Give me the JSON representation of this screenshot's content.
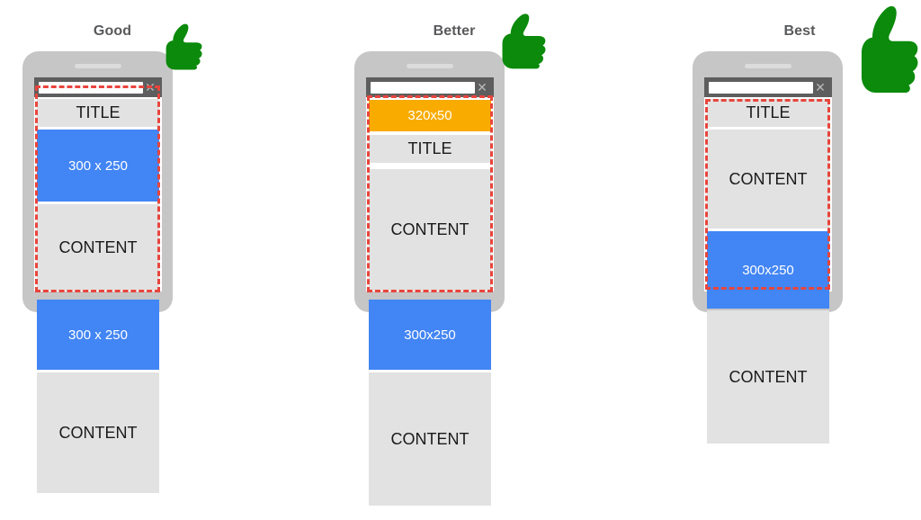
{
  "columns": [
    {
      "title": "Good",
      "browser": {
        "close_icon": "close-icon",
        "url_value": ""
      },
      "blocks": [
        {
          "name": "title-block",
          "label": "TITLE"
        },
        {
          "name": "ad-block",
          "label": "300 x 250"
        },
        {
          "name": "content-block",
          "label": "CONTENT"
        },
        {
          "name": "ad-block-below-fold",
          "label": "300 x 250"
        },
        {
          "name": "content-block-below-fold",
          "label": "CONTENT"
        }
      ]
    },
    {
      "title": "Better",
      "browser": {
        "close_icon": "close-icon",
        "url_value": ""
      },
      "blocks": [
        {
          "name": "banner-ad-block",
          "label": "320x50"
        },
        {
          "name": "title-block",
          "label": "TITLE"
        },
        {
          "name": "content-block",
          "label": "CONTENT"
        },
        {
          "name": "ad-block-below-fold",
          "label": "300x250"
        },
        {
          "name": "content-block-below-fold",
          "label": "CONTENT"
        }
      ]
    },
    {
      "title": "Best",
      "browser": {
        "close_icon": "close-icon",
        "url_value": ""
      },
      "blocks": [
        {
          "name": "title-block",
          "label": "TITLE"
        },
        {
          "name": "content-block",
          "label": "CONTENT"
        },
        {
          "name": "ad-block",
          "label": "300x250"
        },
        {
          "name": "content-block-below-fold",
          "label": "CONTENT"
        }
      ]
    }
  ],
  "icons": {
    "thumbs_up": "thumbs-up-icon"
  },
  "colors": {
    "ad_blue": "#4285f4",
    "banner_amber": "#f9ab00",
    "content_grey": "#e2e2e2",
    "phone_frame": "#c6c6c6",
    "chrome_bar": "#5e5e5e",
    "viewport_outline_red": "#e8453c",
    "thumb_green": "#0b8a0b",
    "title_text": "#58595b"
  }
}
